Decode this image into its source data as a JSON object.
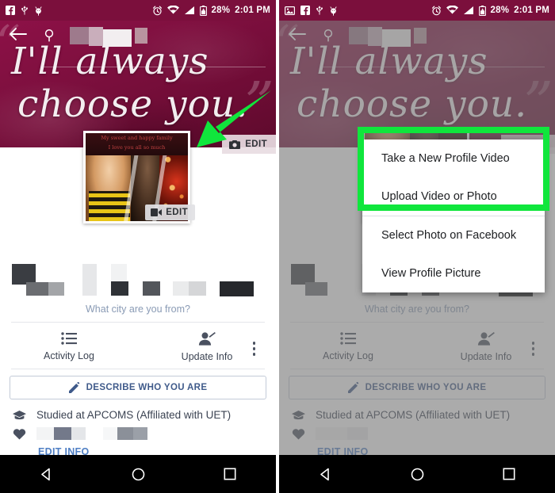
{
  "statusbar": {
    "left_icons_left_panel": [
      "facebook-icon",
      "usb-icon",
      "android-debug-icon"
    ],
    "left_icons_right_panel": [
      "image-icon",
      "facebook-icon",
      "usb-icon",
      "android-debug-icon"
    ],
    "right_icons": [
      "alarm-icon",
      "wifi-icon",
      "signal-icon",
      "battery-icon"
    ],
    "battery": "28%",
    "time": "2:01 PM"
  },
  "cover": {
    "quote_line1": "I'll always",
    "quote_line2": "choose you.",
    "open_quote": "“",
    "close_quote": "”",
    "back_icon": "back-arrow-icon",
    "search_icon": "search-icon",
    "edit_cover_label": "EDIT",
    "edit_cover_icon": "camera-icon"
  },
  "profile": {
    "edit_video_label": "EDIT",
    "edit_video_icon": "video-camera-icon",
    "video_banner_line1": "My sweet and happy family",
    "video_banner_line2": "I love you all so much"
  },
  "body": {
    "city_prompt": "What city are you from?",
    "actions": [
      {
        "label": "Activity Log",
        "icon": "list-icon"
      },
      {
        "label": "Update Info",
        "icon": "person-edit-icon"
      }
    ],
    "more_icon": "kebab-menu-icon",
    "describe_button": "DESCRIBE WHO YOU ARE",
    "describe_icon": "pencil-icon",
    "education": "Studied at APCOMS (Affiliated with UET)",
    "education_icon": "graduation-cap-icon",
    "relationship_icon": "heart-icon",
    "edit_info_link": "EDIT INFO"
  },
  "menu": {
    "items": [
      "Take a New Profile Video",
      "Upload Video or Photo",
      "Select Photo on Facebook",
      "View Profile Picture"
    ],
    "highlight_color": "#10e63c"
  },
  "annotation": {
    "arrow_color": "#10e63c",
    "arrow_name": "green-pointer-arrow"
  },
  "navbar": {
    "back": "back-triangle-icon",
    "home": "home-circle-icon",
    "recents": "recents-square-icon"
  }
}
